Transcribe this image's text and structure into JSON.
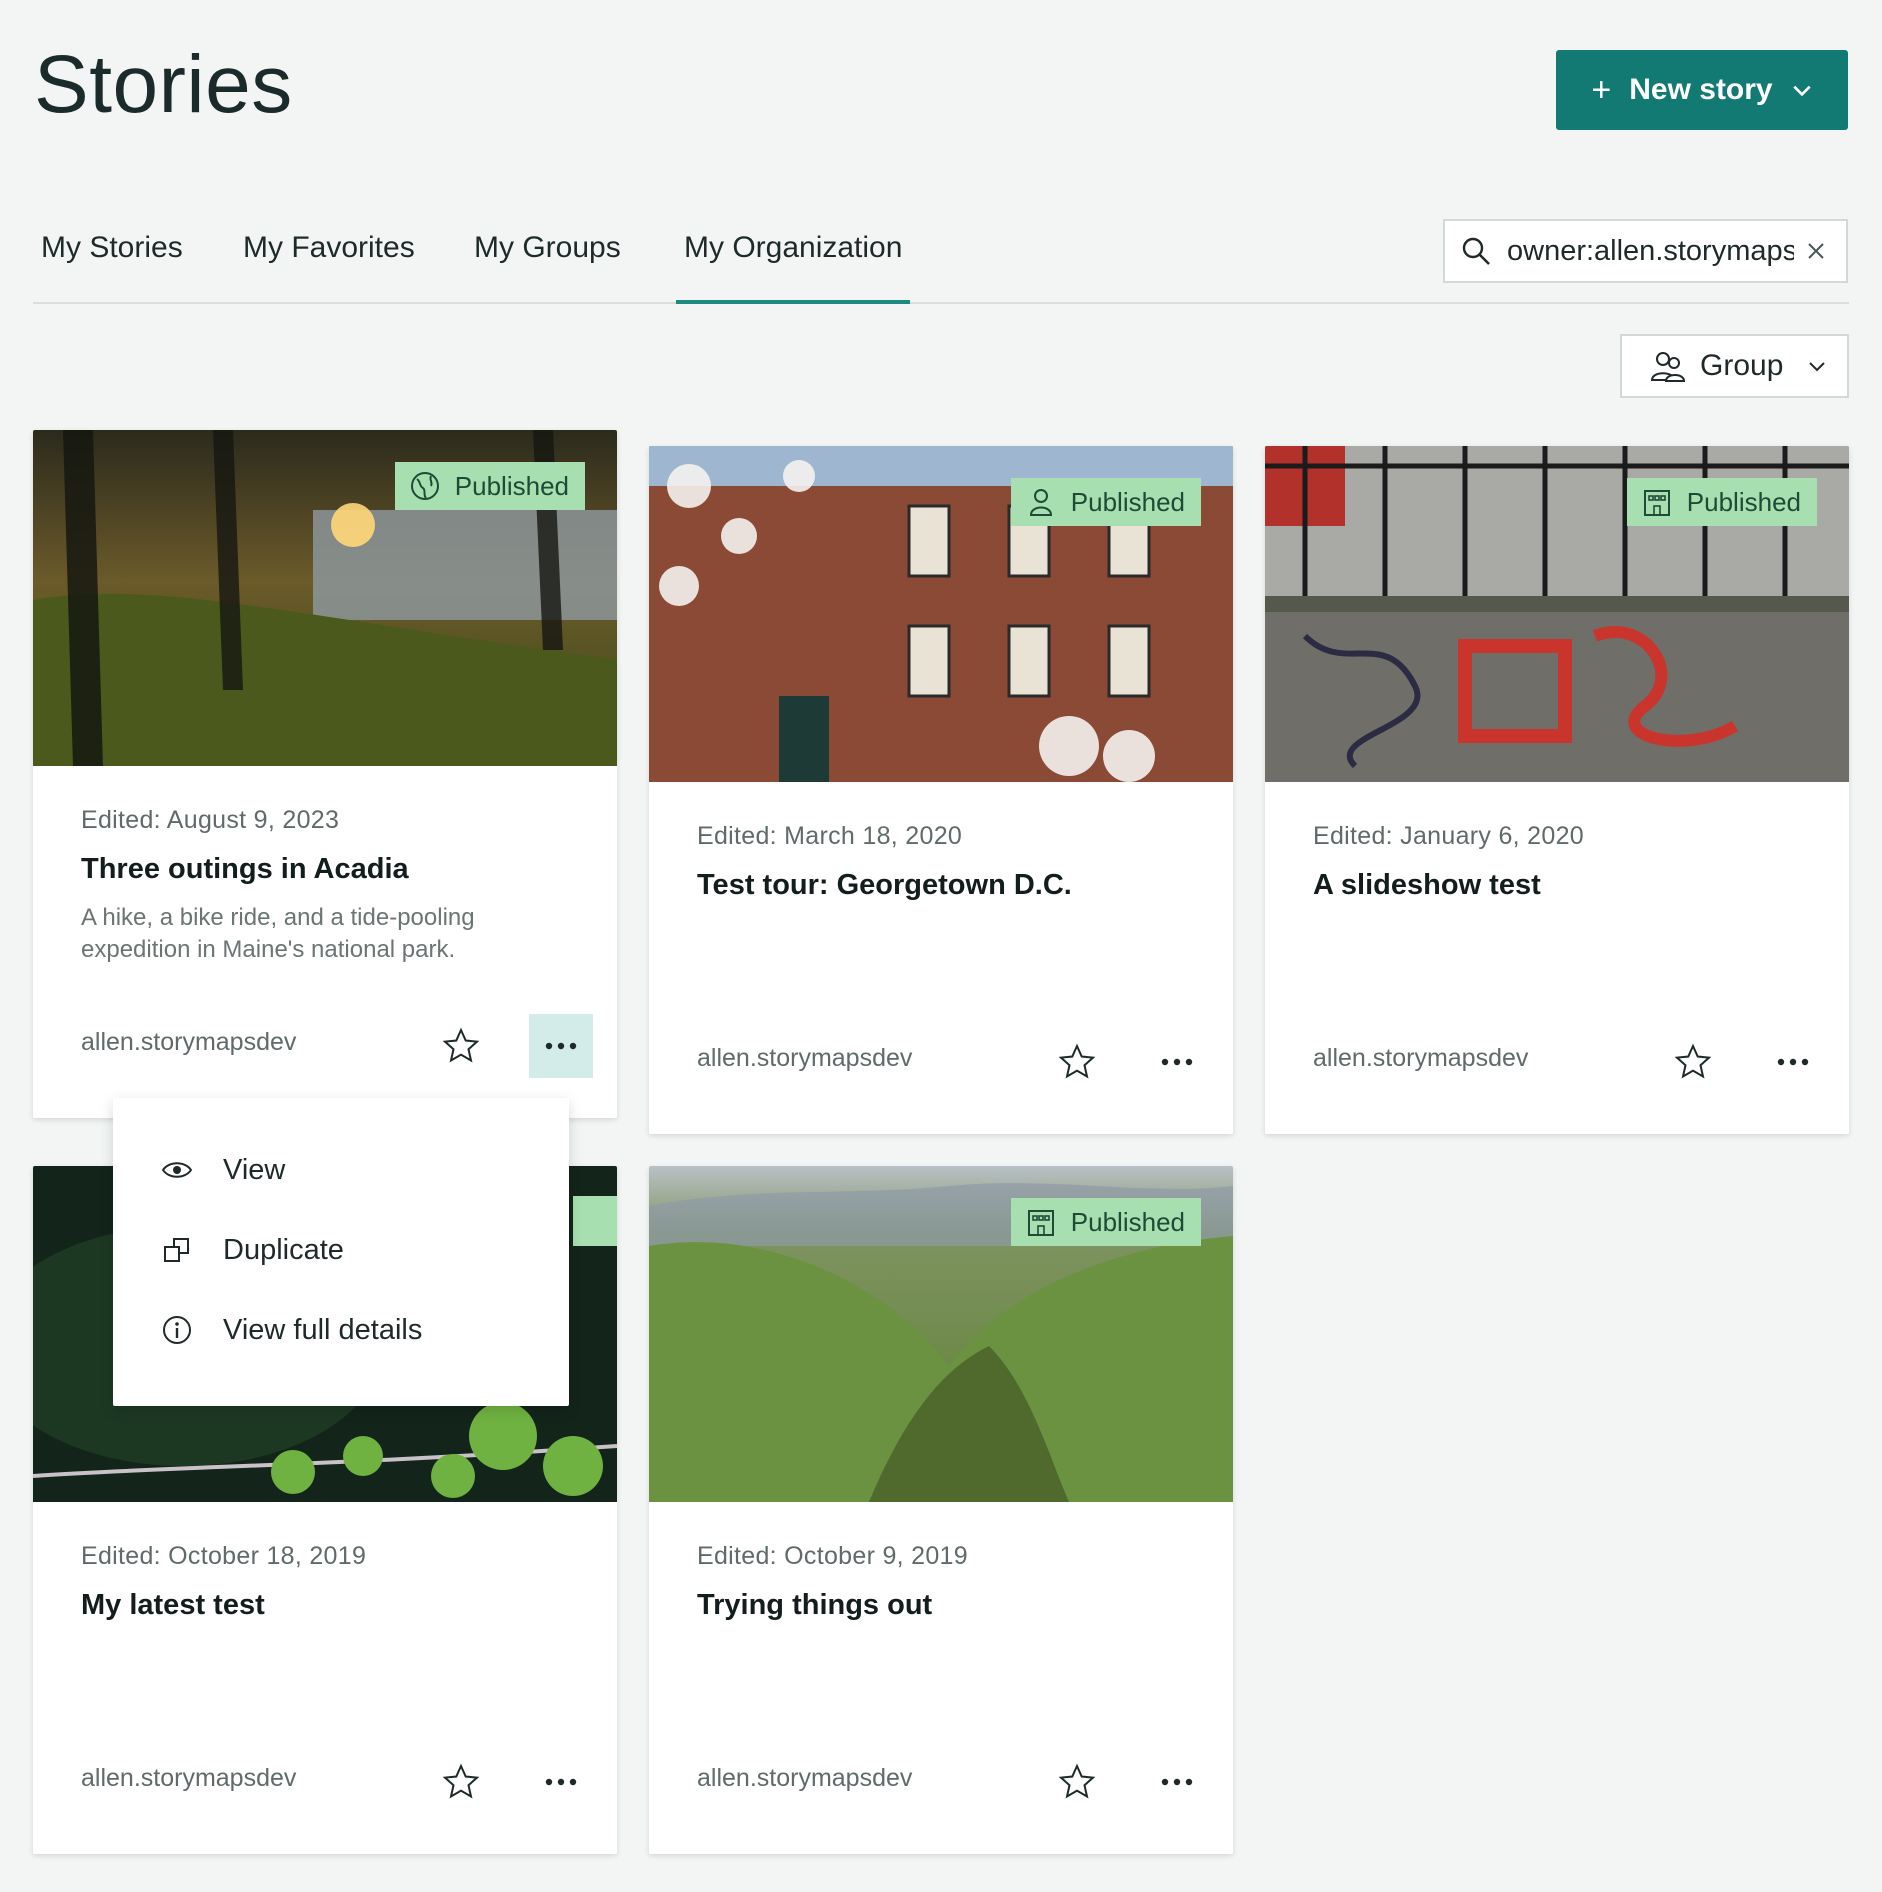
{
  "page": {
    "title": "Stories"
  },
  "header": {
    "new_story_label": "New story"
  },
  "tabs": [
    {
      "label": "My Stories"
    },
    {
      "label": "My Favorites"
    },
    {
      "label": "My Groups"
    },
    {
      "label": "My Organization",
      "active": true
    }
  ],
  "search": {
    "value": "owner:allen.storymapsdev"
  },
  "filter": {
    "group_label": "Group"
  },
  "colors": {
    "accent": "#127a73",
    "badge_bg": "#a7dfb0",
    "active_tab_underline": "#1f8a80"
  },
  "cards": [
    {
      "edited": "Edited: August 9, 2023",
      "title": "Three outings in Acadia",
      "description": "A hike, a bike ride, and a tide-pooling expedition in Maine's national park.",
      "owner": "allen.storymapsdev",
      "status": "Published",
      "status_icon": "globe-icon"
    },
    {
      "edited": "Edited: March 18, 2020",
      "title": "Test tour: Georgetown D.C.",
      "owner": "allen.storymapsdev",
      "status": "Published",
      "status_icon": "person-icon"
    },
    {
      "edited": "Edited: January 6, 2020",
      "title": "A slideshow test",
      "owner": "allen.storymapsdev",
      "status": "Published",
      "status_icon": "building-icon"
    },
    {
      "edited": "Edited: October 18, 2019",
      "title": "My latest test",
      "owner": "allen.storymapsdev"
    },
    {
      "edited": "Edited: October 9, 2019",
      "title": "Trying things out",
      "owner": "allen.storymapsdev",
      "status": "Published",
      "status_icon": "building-icon"
    }
  ],
  "context_menu": {
    "items": [
      {
        "label": "View",
        "icon": "eye-icon"
      },
      {
        "label": "Duplicate",
        "icon": "duplicate-icon"
      },
      {
        "label": "View full details",
        "icon": "info-icon"
      }
    ]
  }
}
